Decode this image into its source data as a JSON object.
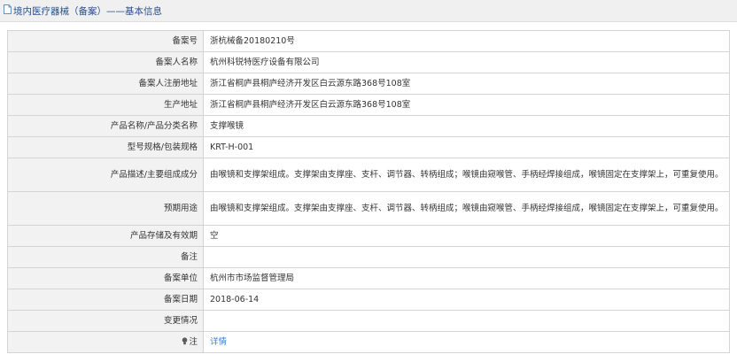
{
  "header": {
    "title": "境内医疗器械（备案）——基本信息"
  },
  "rows": {
    "filing_no": {
      "label": "备案号",
      "value": "浙杭械备20180210号"
    },
    "filer_name": {
      "label": "备案人名称",
      "value": "杭州科锐特医疗设备有限公司"
    },
    "filer_address": {
      "label": "备案人注册地址",
      "value": "浙江省桐庐县桐庐经济开发区白云源东路368号108室"
    },
    "production_address": {
      "label": "生产地址",
      "value": "浙江省桐庐县桐庐经济开发区白云源东路368号108室"
    },
    "product_name": {
      "label": "产品名称/产品分类名称",
      "value": "支撑喉镜"
    },
    "model_spec": {
      "label": "型号规格/包装规格",
      "value": "KRT-H-001"
    },
    "description": {
      "label": "产品描述/主要组成成分",
      "value": "由喉镜和支撑架组成。支撑架由支撑座、支杆、调节器、转柄组成；喉镜由窥喉管、手柄经焊接组成，喉镜固定在支撑架上，可重复使用。"
    },
    "intended_use": {
      "label": "预期用途",
      "value": "由喉镜和支撑架组成。支撑架由支撑座、支杆、调节器、转柄组成；喉镜由窥喉管、手柄经焊接组成，喉镜固定在支撑架上，可重复使用。"
    },
    "storage": {
      "label": "产品存储及有效期",
      "value": "空"
    },
    "remarks": {
      "label": "备注",
      "value": ""
    },
    "filing_unit": {
      "label": "备案单位",
      "value": "杭州市市场监督管理局"
    },
    "filing_date": {
      "label": "备案日期",
      "value": "2018-06-14"
    },
    "change_info": {
      "label": "变更情况",
      "value": ""
    },
    "note": {
      "label": "注",
      "value": "详情"
    }
  },
  "icons": {
    "title_icon": "document-icon",
    "note_icon": "lightbulb-icon"
  },
  "colors": {
    "title": "#2a4f86",
    "link": "#3a7fd5",
    "label_bg": "#f2f2f2",
    "border": "#d4d4d4"
  }
}
